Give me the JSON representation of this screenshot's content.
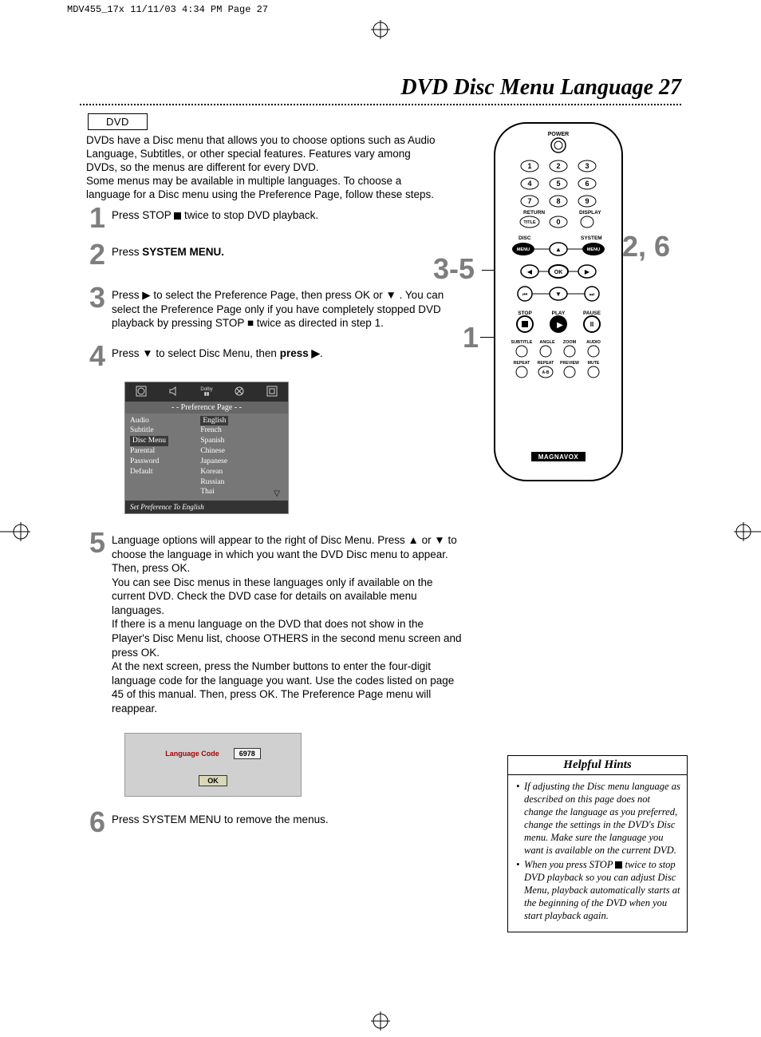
{
  "print_header": "MDV455_17x  11/11/03  4:34 PM  Page 27",
  "page_title": "DVD Disc Menu Language  27",
  "dvd_box": "DVD",
  "intro_p1": "DVDs have a Disc menu that allows you to choose options such as Audio Language, Subtitles, or other special features. Features vary among DVDs, so the menus are different for every DVD.",
  "intro_p2": "Some menus may be available in multiple languages. To choose a language for a Disc menu using the Preference Page, follow these steps.",
  "steps": {
    "n1": "1",
    "t1_a": "Press STOP ",
    "t1_b": " twice to stop DVD playback.",
    "n2": "2",
    "t2_a": "Press ",
    "t2_b": "SYSTEM MENU.",
    "n3": "3",
    "t3": "Press ▶ to select the Preference Page, then press OK or ▼ . You can select the Preference Page only if you have completely stopped DVD playback by pressing STOP ■ twice as directed in step 1.",
    "n4": "4",
    "t4_a": "Press ▼ to select Disc Menu, then ",
    "t4_b": "press ▶",
    "t4_c": ".",
    "n5": "5",
    "t5_p1": "Language options will appear to the right of Disc Menu. Press ▲ or ▼ to choose the language in which you want the DVD Disc menu to appear. Then, press OK.",
    "t5_p2": "You can see Disc menus in these languages only if available on the current DVD. Check the DVD case for details on available menu languages.",
    "t5_p3": "If there is a menu language on the DVD that does not show in the Player's Disc Menu list, choose OTHERS in the second menu screen and press OK.",
    "t5_p4": "At the next screen, press the Number buttons to enter the four-digit language code for the language you want. Use the codes listed on page 45 of this manual. Then, press OK. The Preference Page menu will reappear.",
    "n6": "6",
    "t6": "Press SYSTEM MENU to remove the menus."
  },
  "pref": {
    "title": "- -   Preference Page   - -",
    "left": [
      "Audio",
      "Subtitle",
      "Disc Menu",
      "Parental",
      "Password",
      "Default"
    ],
    "right": [
      "English",
      "French",
      "Spanish",
      "Chinese",
      "Japanese",
      "Korean",
      "Russian",
      "Thai"
    ],
    "footer": "Set Preference To English",
    "dolby": "Dolby"
  },
  "lang_code": {
    "label": "Language Code",
    "value": "6978",
    "ok": "OK"
  },
  "callouts": {
    "c35": "3-5",
    "c1": "1",
    "c26": "2, 6"
  },
  "remote": {
    "power": "POWER",
    "return": "RETURN",
    "display": "DISPLAY",
    "title": "TITLE",
    "disc_menu": "DISC\nMENU",
    "system_menu": "SYSTEM\nMENU",
    "menu_l": "MENU",
    "menu_r": "MENU",
    "ok": "OK",
    "stop": "STOP",
    "play": "PLAY",
    "pause": "PAUSE",
    "row_labels": [
      "SUBTITLE",
      "ANGLE",
      "ZOOM",
      "AUDIO"
    ],
    "row2_labels": [
      "REPEAT",
      "REPEAT\nA-B",
      "PREVIEW",
      "MUTE"
    ],
    "brand": "MAGNAVOX",
    "digits": [
      "1",
      "2",
      "3",
      "4",
      "5",
      "6",
      "7",
      "8",
      "9",
      "0"
    ]
  },
  "hints": {
    "title": "Helpful Hints",
    "b1": "If adjusting the Disc menu language as described on this page does not change the language as you preferred, change the settings in the DVD's Disc menu. Make sure the language you want is available on the current DVD.",
    "b2_a": "When you press STOP ",
    "b2_b": " twice to stop DVD playback so you can adjust Disc Menu, playback automatically starts at the beginning of the DVD when you start playback again."
  }
}
